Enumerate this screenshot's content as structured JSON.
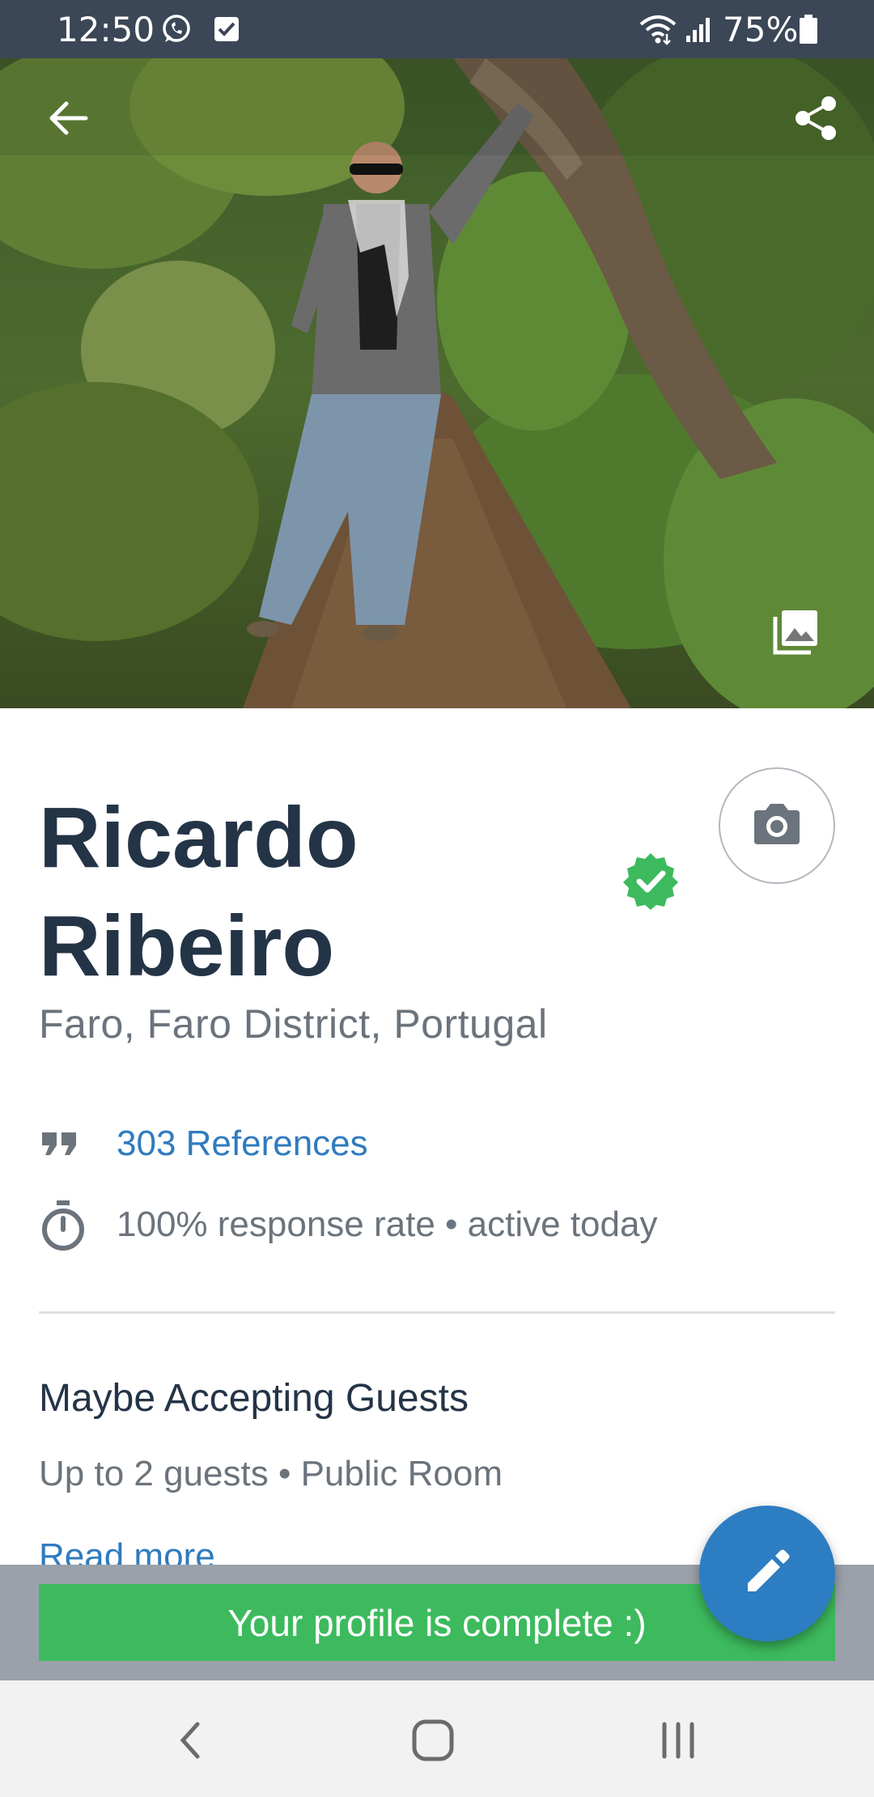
{
  "status_bar": {
    "time": "12:50",
    "battery": "75%",
    "icons": [
      "whatsapp-icon",
      "checkbox-icon",
      "wifi-icon",
      "signal-icon",
      "battery-icon"
    ]
  },
  "hero": {
    "icons": [
      "back-arrow-icon",
      "share-icon",
      "photo-gallery-icon"
    ]
  },
  "profile": {
    "name": "Ricardo Ribeiro",
    "location": "Faro, Faro District, Portugal",
    "references": "303 References",
    "response": "100% response rate • active today",
    "verified_color": "#3dba5d"
  },
  "hosting": {
    "status": "Maybe Accepting Guests",
    "details": "Up to 2 guests • Public Room",
    "read_more": "Read more"
  },
  "banner": {
    "text": "Your profile is complete :)",
    "color": "#3dba5d"
  },
  "fab": {
    "icon": "pencil-icon",
    "color": "#2d7dc2"
  },
  "nav_bar": {
    "icons": [
      "nav-back-icon",
      "nav-home-icon",
      "nav-recents-icon"
    ]
  }
}
